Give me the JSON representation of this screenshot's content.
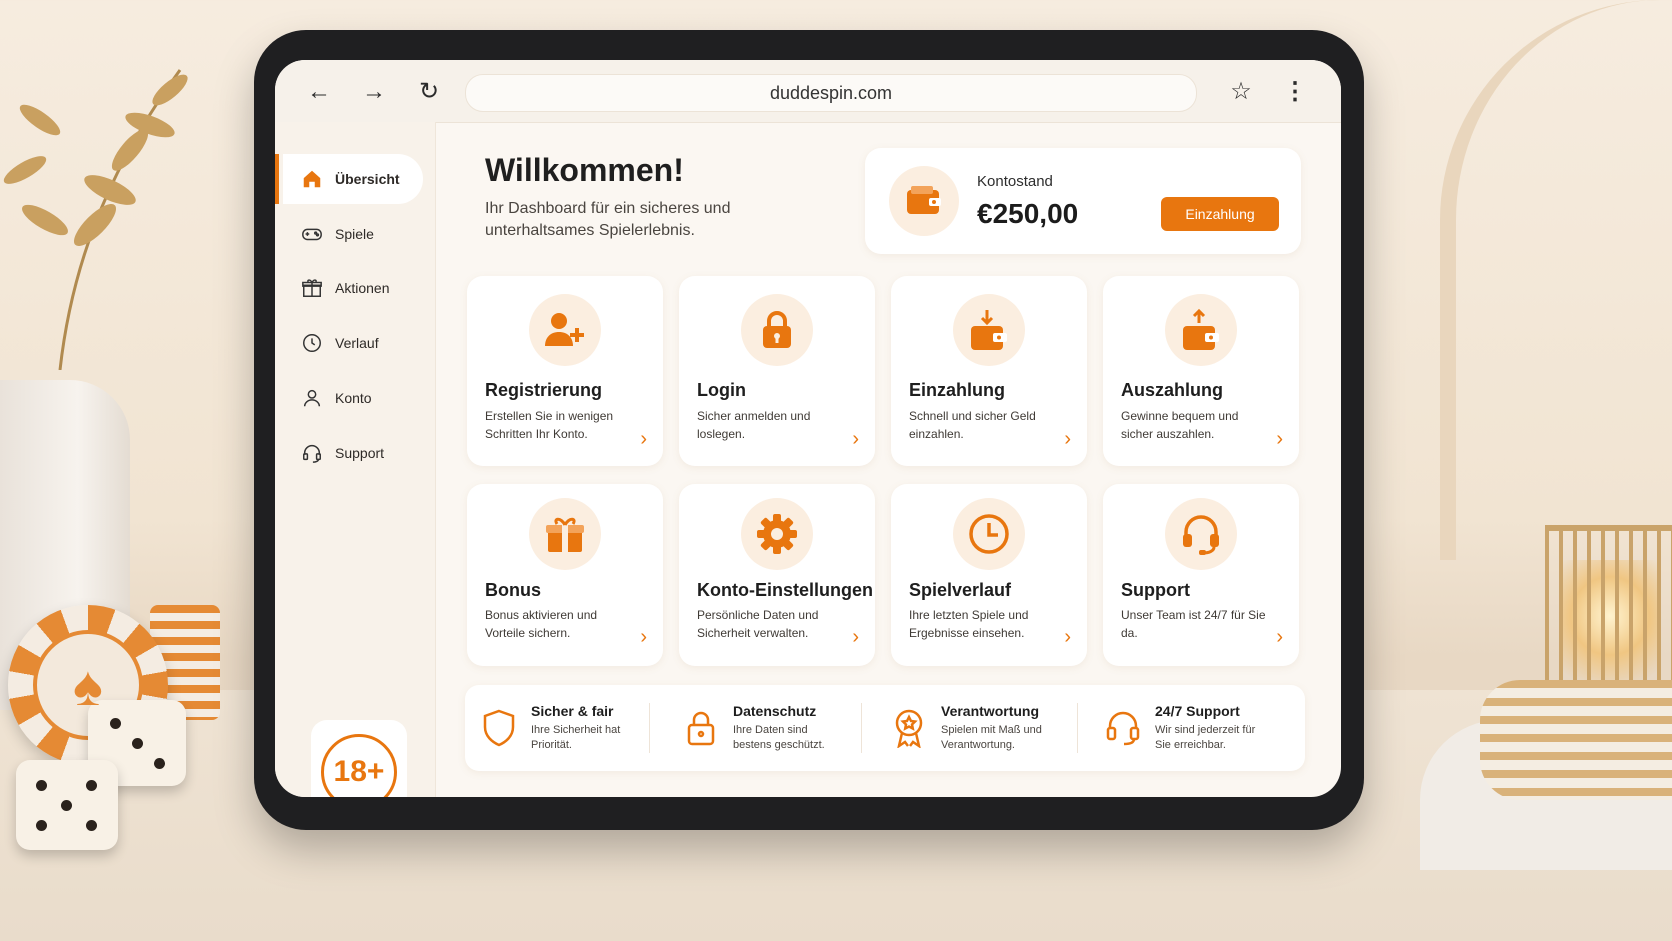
{
  "browser": {
    "url": "duddespin.com"
  },
  "sidebar": {
    "items": [
      {
        "label": "Übersicht",
        "icon": "home-icon",
        "active": true
      },
      {
        "label": "Spiele",
        "icon": "gamepad-icon",
        "active": false
      },
      {
        "label": "Aktionen",
        "icon": "gift-icon",
        "active": false
      },
      {
        "label": "Verlauf",
        "icon": "clock-icon",
        "active": false
      },
      {
        "label": "Konto",
        "icon": "user-icon",
        "active": false
      },
      {
        "label": "Support",
        "icon": "headset-icon",
        "active": false
      }
    ],
    "age_badge": "18+"
  },
  "welcome": {
    "title": "Willkommen!",
    "subtitle": "Ihr Dashboard für ein sicheres und unterhaltsames Spielerlebnis."
  },
  "balance": {
    "label": "Kontostand",
    "value": "€250,00",
    "button_label": "Einzahlung",
    "icon": "wallet-icon"
  },
  "tiles": [
    {
      "title": "Registrierung",
      "desc": "Erstellen Sie in wenigen Schritten Ihr Konto.",
      "icon": "add-user-icon"
    },
    {
      "title": "Login",
      "desc": "Sicher anmelden und loslegen.",
      "icon": "lock-icon"
    },
    {
      "title": "Einzahlung",
      "desc": "Schnell und sicher Geld einzahlen.",
      "icon": "wallet-deposit-icon"
    },
    {
      "title": "Auszahlung",
      "desc": "Gewinne bequem und sicher auszahlen.",
      "icon": "wallet-withdraw-icon"
    },
    {
      "title": "Bonus",
      "desc": "Bonus aktivieren und Vorteile sichern.",
      "icon": "gift-icon"
    },
    {
      "title": "Konto-Einstellungen",
      "desc": "Persönliche Daten und Sicherheit verwalten.",
      "icon": "gear-icon"
    },
    {
      "title": "Spielverlauf",
      "desc": "Ihre letzten Spiele und Ergebnisse einsehen.",
      "icon": "clock-icon"
    },
    {
      "title": "Support",
      "desc": "Unser Team ist 24/7 für Sie da.",
      "icon": "headset-icon"
    }
  ],
  "trust": [
    {
      "title": "Sicher & fair",
      "desc": "Ihre Sicherheit hat Priorität.",
      "icon": "shield-icon"
    },
    {
      "title": "Datenschutz",
      "desc": "Ihre Daten sind bestens geschützt.",
      "icon": "lock-icon"
    },
    {
      "title": "Verantwortung",
      "desc": "Spielen mit Maß und Verantwortung.",
      "icon": "award-icon"
    },
    {
      "title": "24/7 Support",
      "desc": "Wir sind jederzeit für Sie erreichbar.",
      "icon": "headset-icon"
    }
  ],
  "colors": {
    "accent": "#e8760f",
    "icon_bg": "#fbeee0",
    "screen_bg": "#fbf7f2"
  }
}
